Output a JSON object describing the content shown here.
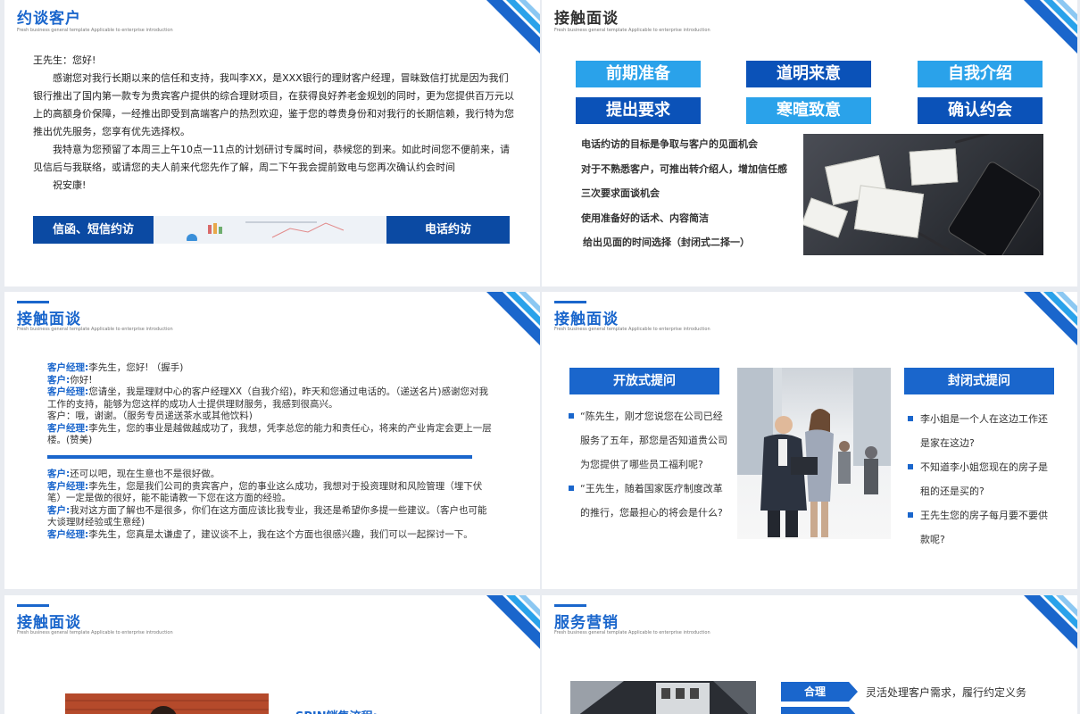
{
  "subtitle_en": "Fresh business general template Applicable to enterprise introduction",
  "colors": {
    "accent": "#1a66cc",
    "dark": "#0b52b8",
    "light": "#2aa2ea"
  },
  "slide1": {
    "title": "约谈客户",
    "greeting": "王先生：您好!",
    "para1": "感谢您对我行长期以来的信任和支持，我叫李XX，是XXX银行的理财客户经理，冒昧致信打扰是因为我们银行推出了国内第一款专为贵宾客户提供的综合理财项目，在获得良好养老金规划的同时，更为您提供百万元以上的高额身价保障，一经推出即受到高端客户的热烈欢迎，鉴于您的尊贵身份和对我行的长期信赖，我行特为您推出优先服务，您享有优先选择权。",
    "para2": "我特意为您预留了本周三上午10点一11点的计划研讨专属时间，恭候您的到来。如此时间您不便前来，请见信后与我联络，或请您的夫人前来代您先作了解，周二下午我会提前致电与您再次确认约会时间",
    "closing": "祝安康!",
    "btn_left": "信函、短信约访",
    "btn_right": "电话约访"
  },
  "slide2": {
    "title": "接触面谈",
    "chips": [
      "前期准备",
      "道明来意",
      "自我介绍",
      "提出要求",
      "寒暄致意",
      "确认约会"
    ],
    "lines": [
      "电话约访的目标是争取与客户的见面机会",
      "对于不熟悉客户，可推出转介绍人，增加信任感",
      "三次要求面谈机会",
      "使用准备好的话术、内容简洁",
      "给出见面的时间选择（封闭式二择一）"
    ]
  },
  "slide3": {
    "title": "接触面谈",
    "block1": [
      {
        "speaker": "客户经理:",
        "text": "李先生，您好! （握手)"
      },
      {
        "speaker": "客户:",
        "text": "你好!"
      },
      {
        "speaker": "客户经理:",
        "text": "您请坐，我是理财中心的客户经理XX（自我介绍)，昨天和您通过电话的。（递送名片)感谢您对我工作的支持，能够为您这样的成功人士提供理财服务，我感到很高兴。"
      },
      {
        "speaker": "",
        "text": "客户：哦，谢谢。（服务专员递送茶水或其他饮料)"
      },
      {
        "speaker": "客户经理:",
        "text": "李先生，您的事业是越做越成功了，我想，凭李总您的能力和责任心，将来的产业肯定会更上一层楼。(赞美)"
      }
    ],
    "block2": [
      {
        "speaker": "客户:",
        "text": "还可以吧，现在生意也不是很好做。"
      },
      {
        "speaker": "客户经理:",
        "text": "李先生，您是我们公司的贵宾客户，您的事业这么成功，我想对于投资理财和风险管理（埋下伏笔）一定是做的很好，能不能请教一下您在这方面的经验。"
      },
      {
        "speaker": "客户:",
        "text": "我对这方面了解也不是很多，你们在这方面应该比我专业，我还是希望你多提一些建议。（客户也可能大谈理财经验或生意经)"
      },
      {
        "speaker": "客户经理:",
        "text": "李先生，您真是太谦虚了，建议谈不上，我在这个方面也很感兴趣，我们可以一起探讨一下。"
      }
    ]
  },
  "slide4": {
    "title": "接触面谈",
    "open_title": "开放式提问",
    "open_items": [
      "“陈先生，刚才您说您在公司已经服务了五年，那您是否知道贵公司为您提供了哪些员工福利呢?",
      "“王先生，随着国家医疗制度改革的推行，您最担心的将会是什么?"
    ],
    "closed_title": "封闭式提问",
    "closed_items": [
      "李小姐是一个人在这边工作还是家在这边?",
      "不知道李小姐您现在的房子是租的还是买的?",
      "王先生您的房子每月要不要供款呢?"
    ]
  },
  "slide5": {
    "title": "接触面谈",
    "heading": "SPIN销售流程:"
  },
  "slide6": {
    "title": "服务营销",
    "tag1": "合理",
    "text1": "灵活处理客户需求，履行约定义务"
  }
}
